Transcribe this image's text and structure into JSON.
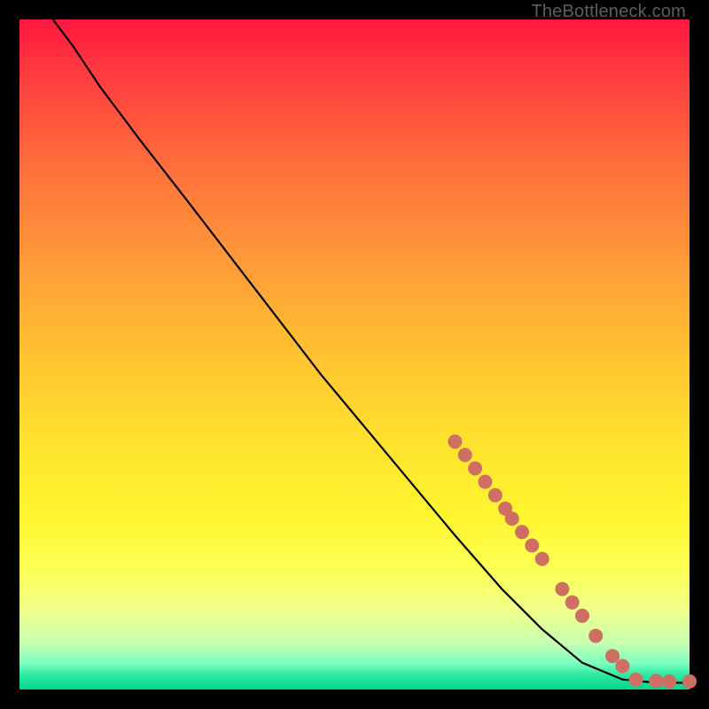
{
  "watermark": "TheBottleneck.com",
  "chart_data": {
    "type": "line",
    "title": "",
    "xlabel": "",
    "ylabel": "",
    "xlim": [
      0,
      100
    ],
    "ylim": [
      0,
      100
    ],
    "series": [
      {
        "name": "curve",
        "style": "solid-black",
        "points": [
          {
            "x": 5,
            "y": 100
          },
          {
            "x": 8,
            "y": 96
          },
          {
            "x": 12,
            "y": 90
          },
          {
            "x": 18,
            "y": 82
          },
          {
            "x": 25,
            "y": 73
          },
          {
            "x": 35,
            "y": 60
          },
          {
            "x": 45,
            "y": 47
          },
          {
            "x": 55,
            "y": 35
          },
          {
            "x": 65,
            "y": 23
          },
          {
            "x": 72,
            "y": 15
          },
          {
            "x": 78,
            "y": 9
          },
          {
            "x": 84,
            "y": 4
          },
          {
            "x": 90,
            "y": 1.5
          },
          {
            "x": 95,
            "y": 1
          },
          {
            "x": 100,
            "y": 1
          }
        ]
      },
      {
        "name": "dots",
        "style": "salmon-dots",
        "points": [
          {
            "x": 65,
            "y": 37
          },
          {
            "x": 66.5,
            "y": 35
          },
          {
            "x": 68,
            "y": 33
          },
          {
            "x": 69.5,
            "y": 31
          },
          {
            "x": 71,
            "y": 29
          },
          {
            "x": 72.5,
            "y": 27
          },
          {
            "x": 73.5,
            "y": 25.5
          },
          {
            "x": 75,
            "y": 23.5
          },
          {
            "x": 76.5,
            "y": 21.5
          },
          {
            "x": 78,
            "y": 19.5
          },
          {
            "x": 81,
            "y": 15
          },
          {
            "x": 82.5,
            "y": 13
          },
          {
            "x": 84,
            "y": 11
          },
          {
            "x": 86,
            "y": 8
          },
          {
            "x": 88.5,
            "y": 5
          },
          {
            "x": 90,
            "y": 3.5
          },
          {
            "x": 92,
            "y": 1.5
          },
          {
            "x": 95,
            "y": 1.3
          },
          {
            "x": 97,
            "y": 1.2
          },
          {
            "x": 100,
            "y": 1.2
          }
        ]
      }
    ],
    "colors": {
      "curve": "#000000",
      "dots": "#cf6f63"
    }
  }
}
